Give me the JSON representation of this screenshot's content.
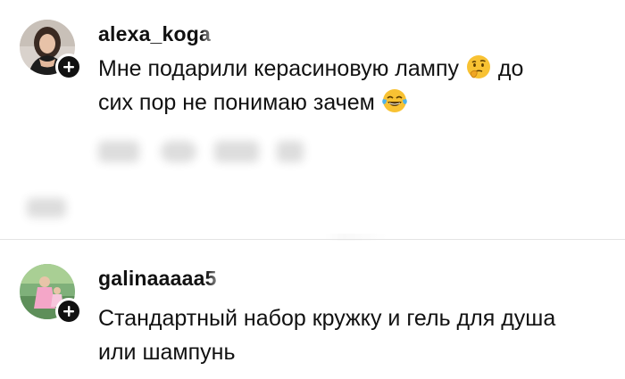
{
  "comments": [
    {
      "username": "alexa_koga",
      "text_parts": [
        "Мне подарили керасиновую лампу",
        "до",
        "сих пор не понимаю зачем"
      ],
      "emojis": [
        "thinking-face",
        "face-with-tears-of-joy"
      ],
      "avatar_icon": "user-avatar",
      "follow_icon": "plus-icon"
    },
    {
      "username": "galinaaaaa5",
      "text_parts": [
        "Стандартный набор кружку и гель для душа",
        "или шампунь"
      ],
      "avatar_icon": "user-avatar",
      "follow_icon": "plus-icon"
    }
  ],
  "colors": {
    "text": "#111111",
    "badge": "#111111",
    "divider": "#e4e4e4",
    "emoji_yellow": "#f8c233"
  }
}
